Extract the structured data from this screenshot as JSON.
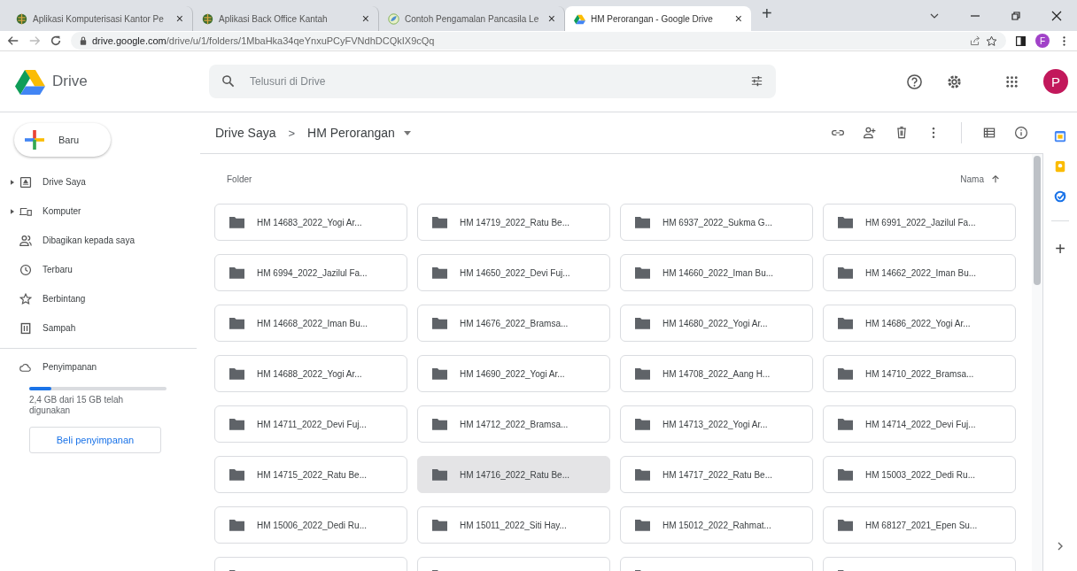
{
  "browser": {
    "tabs": [
      {
        "title": "Aplikasi Komputerisasi Kantor Pe",
        "kind": "globe",
        "selected": false
      },
      {
        "title": "Aplikasi Back Office Kantah",
        "kind": "globe",
        "selected": false
      },
      {
        "title": "Contoh Pengamalan Pancasila Le",
        "kind": "leaf",
        "selected": false
      },
      {
        "title": "HM Perorangan - Google Drive",
        "kind": "drive",
        "selected": true
      }
    ],
    "close_glyph": "×",
    "new_tab_glyph": "+",
    "url_host": "drive.google.com",
    "url_path": "/drive/u/1/folders/1MbaHka34qeYnxuPCyFVNdhDCQkIX9cQq",
    "profile_initial": "F"
  },
  "app": {
    "name": "Drive",
    "search": {
      "placeholder": "Telusuri di Drive"
    },
    "avatar_initial": "P"
  },
  "sidebar": {
    "new_button": "Baru",
    "items": [
      {
        "label": "Drive Saya",
        "kind": "drive",
        "expandable": true
      },
      {
        "label": "Komputer",
        "kind": "computer",
        "expandable": true
      },
      {
        "label": "Dibagikan kepada saya",
        "kind": "shared",
        "expandable": false
      },
      {
        "label": "Terbaru",
        "kind": "recent",
        "expandable": false
      },
      {
        "label": "Berbintang",
        "kind": "starred",
        "expandable": false
      },
      {
        "label": "Sampah",
        "kind": "trash",
        "expandable": false
      }
    ],
    "storage": {
      "label": "Penyimpanan",
      "level": 0.16,
      "usage": "2,4 GB dari 15 GB telah digunakan",
      "buy_button": "Beli penyimpanan"
    }
  },
  "breadcrumb": [
    "Drive Saya",
    "HM Perorangan"
  ],
  "breadcrumb_separator": ">",
  "section_label": "Folder",
  "sort_label": "Nama",
  "folders": [
    {
      "name": "HM 14683_2022_Yogi Ar...",
      "selected": false
    },
    {
      "name": "HM 14719_2022_Ratu Be...",
      "selected": false
    },
    {
      "name": "HM 6937_2022_Sukma G...",
      "selected": false
    },
    {
      "name": "HM 6991_2022_Jazilul Fa...",
      "selected": false
    },
    {
      "name": "HM 6994_2022_Jazilul Fa...",
      "selected": false
    },
    {
      "name": "HM 14650_2022_Devi Fuj...",
      "selected": false
    },
    {
      "name": "HM 14660_2022_Iman Bu...",
      "selected": false
    },
    {
      "name": "HM 14662_2022_Iman Bu...",
      "selected": false
    },
    {
      "name": "HM 14668_2022_Iman Bu...",
      "selected": false
    },
    {
      "name": "HM 14676_2022_Bramsa...",
      "selected": false
    },
    {
      "name": "HM 14680_2022_Yogi Ar...",
      "selected": false
    },
    {
      "name": "HM 14686_2022_Yogi Ar...",
      "selected": false
    },
    {
      "name": "HM 14688_2022_Yogi Ar...",
      "selected": false
    },
    {
      "name": "HM 14690_2022_Yogi Ar...",
      "selected": false
    },
    {
      "name": "HM 14708_2022_Aang H...",
      "selected": false
    },
    {
      "name": "HM 14710_2022_Bramsa...",
      "selected": false
    },
    {
      "name": "HM 14711_2022_Devi Fuj...",
      "selected": false
    },
    {
      "name": "HM 14712_2022_Bramsa...",
      "selected": false
    },
    {
      "name": "HM 14713_2022_Yogi Ar...",
      "selected": false
    },
    {
      "name": "HM 14714_2022_Devi Fuj...",
      "selected": false
    },
    {
      "name": "HM 14715_2022_Ratu Be...",
      "selected": false
    },
    {
      "name": "HM 14716_2022_Ratu Be...",
      "selected": true
    },
    {
      "name": "HM 14717_2022_Ratu Be...",
      "selected": false
    },
    {
      "name": "HM 15003_2022_Dedi Ru...",
      "selected": false
    },
    {
      "name": "HM 15006_2022_Dedi Ru...",
      "selected": false
    },
    {
      "name": "HM 15011_2022_Siti Hay...",
      "selected": false
    },
    {
      "name": "HM 15012_2022_Rahmat...",
      "selected": false
    },
    {
      "name": "HM 68127_2021_Epen Su...",
      "selected": false
    }
  ],
  "cut_off_folders": [
    {
      "kind": "folder"
    },
    {
      "kind": "folder"
    },
    {
      "kind": "folder"
    },
    {
      "kind": "folder"
    }
  ],
  "side_panel": {
    "add_glyph": "+"
  }
}
